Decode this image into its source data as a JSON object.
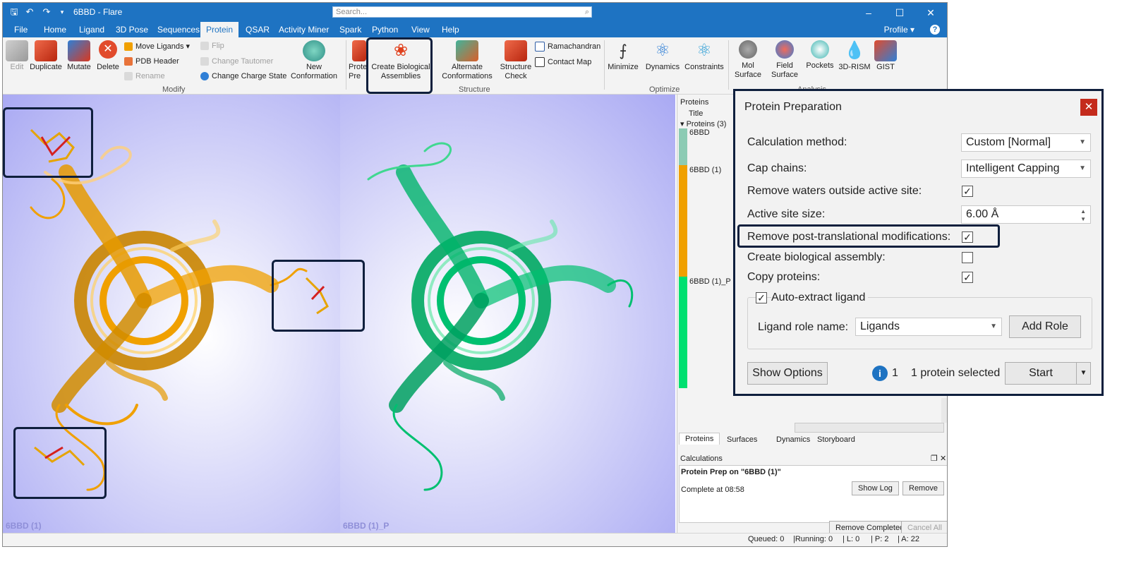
{
  "app": {
    "title": "6BBD - Flare",
    "search_placeholder": "Search...",
    "menu": [
      "File",
      "Home",
      "Ligand",
      "3D Pose",
      "Sequences",
      "Protein",
      "QSAR",
      "Activity Miner",
      "Spark",
      "Python",
      "View",
      "Help"
    ],
    "active_menu": "Protein",
    "profile": "Profile"
  },
  "ribbon": {
    "edit": "Edit",
    "duplicate": "Duplicate",
    "mutate": "Mutate",
    "delete": "Delete",
    "move_ligands": "Move Ligands",
    "flip": "Flip",
    "pdb_header": "PDB Header",
    "change_tautomer": "Change Tautomer",
    "rename": "Rename",
    "change_charge_state": "Change Charge State",
    "new_conformation_1": "New",
    "new_conformation_2": "Conformation",
    "group_modify": "Modify",
    "protein_prep_1": "Prote",
    "protein_prep_2": "Pre",
    "create_bio_1": "Create Biological",
    "create_bio_2": "Assemblies",
    "alt_conf_1": "Alternate",
    "alt_conf_2": "Conformations",
    "structure_check_1": "Structure",
    "structure_check_2": "Check",
    "ramachandran": "Ramachandran",
    "contact_map": "Contact Map",
    "group_structure": "Structure",
    "minimize": "Minimize",
    "dynamics": "Dynamics",
    "constraints": "Constraints",
    "group_optimize": "Optimize",
    "mol_surface_1": "Mol",
    "mol_surface_2": "Surface",
    "field_surface_1": "Field",
    "field_surface_2": "Surface",
    "pockets": "Pockets",
    "rism": "3D-RISM",
    "gist": "GIST",
    "group_analysis": "Analysis"
  },
  "viewports": {
    "left_label": "6BBD (1)",
    "right_label": "6BBD (1)_P"
  },
  "proteins_panel": {
    "header": "Proteins",
    "column_title": "Title",
    "group_label": "Proteins (3)",
    "items": [
      "6BBD",
      "6BBD (1)",
      "6BBD (1)_P"
    ],
    "tabs": [
      "Proteins",
      "Surfaces",
      "Dynamics",
      "Storyboard"
    ]
  },
  "calculations": {
    "header": "Calculations",
    "job_title": "Protein Prep on \"6BBD (1)\"",
    "status": "Complete at 08:58",
    "show_log": "Show Log",
    "remove": "Remove",
    "remove_completed": "Remove Completed",
    "cancel_all": "Cancel All"
  },
  "statusbar": {
    "queued": "Queued: 0",
    "running": "|Running: 0",
    "l": "| L: 0",
    "p": "| P: 2",
    "a": "| A: 22"
  },
  "dialog": {
    "title": "Protein Preparation",
    "calc_method_label": "Calculation method:",
    "calc_method_value": "Custom [Normal]",
    "cap_chains_label": "Cap chains:",
    "cap_chains_value": "Intelligent Capping",
    "remove_waters_label": "Remove waters outside active site:",
    "remove_waters_checked": true,
    "active_site_label": "Active site size:",
    "active_site_value": "6.00 Å",
    "remove_ptm_label": "Remove post-translational modifications:",
    "remove_ptm_checked": true,
    "create_bio_label": "Create biological assembly:",
    "create_bio_checked": false,
    "copy_proteins_label": "Copy proteins:",
    "copy_proteins_checked": true,
    "auto_extract_label": "Auto-extract ligand",
    "auto_extract_checked": true,
    "ligand_role_label": "Ligand role name:",
    "ligand_role_value": "Ligands",
    "add_role": "Add Role",
    "show_options": "Show Options",
    "info_count": "1",
    "selection_text": "1 protein selected",
    "start": "Start"
  },
  "colors": {
    "accent": "#1e73c2",
    "highlight_border": "#0f1f3d",
    "protein_orange": "#f0a000",
    "protein_green": "#00c070",
    "protein_teal": "#8ccbb4"
  }
}
